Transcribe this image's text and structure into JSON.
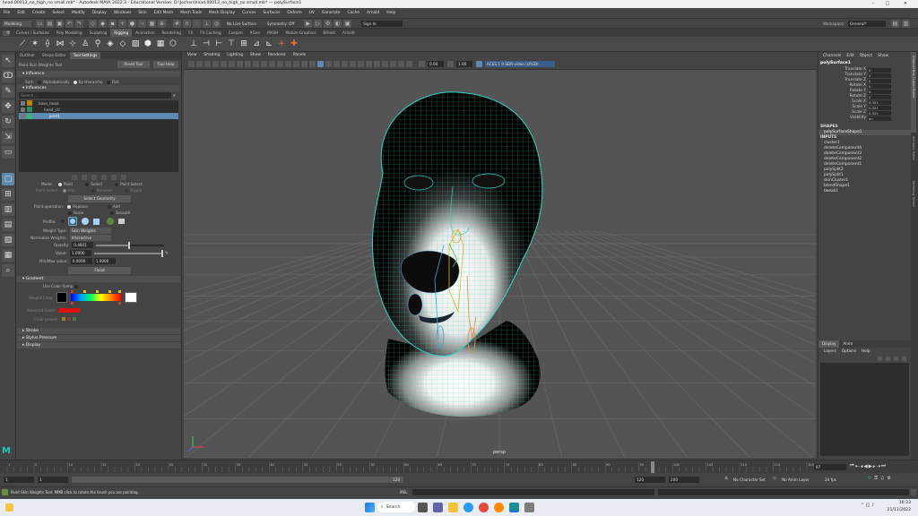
{
  "window": {
    "title": "head.00013_no_high_no small.mb* - Autodesk MAYA 2022.3 - Educational Version: D:\\Jochen\\head.00013_no_high_no small.mb* --- polySurface1"
  },
  "menus": [
    "File",
    "Edit",
    "Create",
    "Select",
    "Modify",
    "Display",
    "Windows",
    "Skin",
    "Edit Mesh",
    "Mesh Tools",
    "Mesh Display",
    "Curves",
    "Surfaces",
    "Deform",
    "UV",
    "Generate",
    "Cache",
    "Arnold",
    "Help"
  ],
  "workspace": {
    "label": "Workspace:",
    "value": "General*"
  },
  "status_line": {
    "mode": "Modeling",
    "live_surface": "No Live Surface",
    "symmetry": "Symmetry: Off",
    "sign_in": "Sign In"
  },
  "shelf_tabs": [
    "Curves / Surfaces",
    "Poly Modeling",
    "Sculpting",
    "Rigging",
    "Animation",
    "Rendering",
    "FX",
    "FX Caching",
    "Custom",
    "XGen",
    "MASH",
    "Motion Graphics",
    "Bifrost",
    "Arnold"
  ],
  "active_shelf": "Rigging",
  "tool_panel": {
    "tabs": [
      "Outliner",
      "Shape Editor",
      "Tool Settings"
    ],
    "active_tab": "Tool Settings",
    "tool_name": "Paint Skin Weights Tool",
    "reset_button": "Reset Tool",
    "help_button": "Tool Help",
    "influence_section": "Influence",
    "sort_label": "Sort:",
    "sort_options": [
      "Alphabetically",
      "By Hierarchy",
      "Flat"
    ],
    "influences_label": "Influences",
    "search_placeholder": "Search...",
    "influence_items": [
      "base_head",
      "head_ctl",
      "joint1"
    ],
    "mode_label": "Mode:",
    "mode_options": [
      "Paint",
      "Select",
      "Paint Select"
    ],
    "paint_select_label": "Paint select:",
    "paint_select_options": [
      "Add",
      "Remove",
      "Toggle"
    ],
    "select_geometry_button": "Select Geometry",
    "paint_operation_label": "Paint operation:",
    "paint_operations": [
      "Replace",
      "Add",
      "Scale",
      "Smooth"
    ],
    "profile_label": "Profile:",
    "weight_type_label": "Weight Type:",
    "weight_type_value": "Skin Weights",
    "normalize_label": "Normalize Weights:",
    "normalize_value": "Interactive",
    "opacity_label": "Opacity:",
    "opacity_value": "0.4841",
    "opacity_level": 0.48,
    "value_label": "Value:",
    "value_value": "1.0000",
    "value_level": 1.0,
    "minmax_label": "Min/Max value:",
    "min_value": "0.0000",
    "max_value": "1.0000",
    "flood_button": "Flood",
    "gradient_section": "Gradient",
    "use_color_ramp": "Use Color Ramp",
    "weight_color_label": "Weight Color:",
    "selected_color_label": "Selected Color:",
    "color_preset_label": "Color preset:",
    "collapsed_sections": [
      "Stroke",
      "Stylus Pressure",
      "Display"
    ]
  },
  "viewport": {
    "menus": [
      "View",
      "Shading",
      "Lighting",
      "Show",
      "Renderer",
      "Panels"
    ],
    "exposure": "0.00",
    "gamma": "1.00",
    "color_space": "ACES 1.0 SDR-video (sRGB)",
    "camera_label": "persp",
    "colors": {
      "bg": "#545454",
      "wire": "#33d3c4",
      "grid": "#6a6a6a"
    }
  },
  "channel_box": {
    "tabs": [
      "Channels",
      "Edit",
      "Object",
      "Show"
    ],
    "object_name": "polySurface1",
    "attributes": [
      {
        "name": "Translate X",
        "value": "0"
      },
      {
        "name": "Translate Y",
        "value": "0"
      },
      {
        "name": "Translate Z",
        "value": "0"
      },
      {
        "name": "Rotate X",
        "value": "0"
      },
      {
        "name": "Rotate Y",
        "value": "0"
      },
      {
        "name": "Rotate Z",
        "value": "0"
      },
      {
        "name": "Scale X",
        "value": "0.321"
      },
      {
        "name": "Scale Y",
        "value": "0.321"
      },
      {
        "name": "Scale Z",
        "value": "0.321"
      },
      {
        "name": "Visibility",
        "value": "on"
      }
    ],
    "shapes_label": "SHAPES",
    "shape_name": "polySurfaceShape1",
    "inputs_label": "INPUTS",
    "inputs": [
      "cluster1",
      "deleteComponent4",
      "deleteComponent3",
      "deleteComponent2",
      "deleteComponent1",
      "polySplit2",
      "polySplit1",
      "skinCluster1",
      "blendShape1",
      "tweak1"
    ]
  },
  "layer_editor": {
    "tabs": [
      "Display",
      "Anim"
    ],
    "menus": [
      "Layers",
      "Options",
      "Help"
    ]
  },
  "side_tabs": [
    "Channel Box / Layer Editor",
    "Attribute Editor",
    "Modeling Toolkit"
  ],
  "time_slider": {
    "ticks": [
      "1",
      "5",
      "10",
      "15",
      "20",
      "25",
      "30",
      "35",
      "40",
      "45",
      "50",
      "55",
      "60",
      "65",
      "70",
      "75",
      "80",
      "85",
      "90",
      "95",
      "100",
      "105",
      "110",
      "115",
      "120"
    ],
    "current_frame": "97"
  },
  "range_slider": {
    "start": "1",
    "start_inner": "1",
    "range_text": "120",
    "end_inner": "120",
    "end": "200",
    "character_set": "No Character Set",
    "anim_layer": "No Anim Layer",
    "fps": "24 fps"
  },
  "command_line": {
    "lang": "MEL"
  },
  "help_line": "Paint Skin Weights Tool: MMB click to rotate the brush you are painting.",
  "taskbar": {
    "search": "Search",
    "time": "16:33",
    "date": "21/11/2022"
  }
}
